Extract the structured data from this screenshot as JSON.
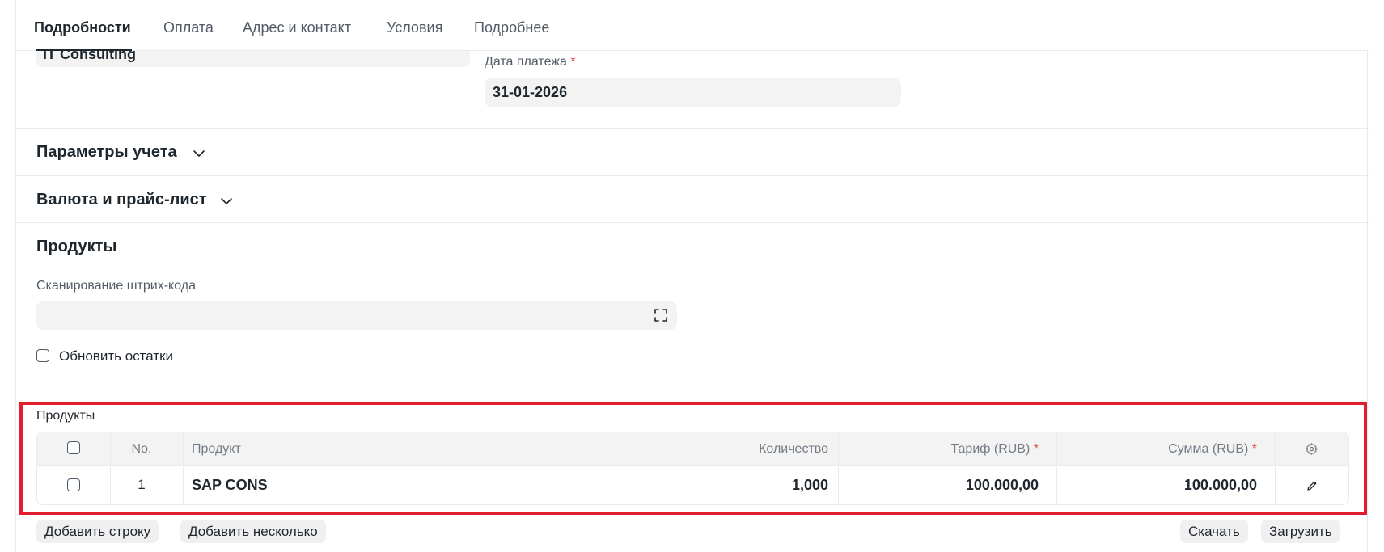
{
  "tabs": [
    {
      "label": "Подробности",
      "active": true
    },
    {
      "label": "Оплата",
      "active": false
    },
    {
      "label": "Адрес и контакт",
      "active": false
    },
    {
      "label": "Условия",
      "active": false
    },
    {
      "label": "Подробнее",
      "active": false
    }
  ],
  "top_field": {
    "value": "IT Consulting"
  },
  "payment_date": {
    "label": "Дата платежа",
    "required_mark": "*",
    "value": "31-01-2026"
  },
  "sections": {
    "accounting": "Параметры учета",
    "currency": "Валюта и прайс-лист",
    "products": "Продукты"
  },
  "barcode": {
    "label": "Сканирование штрих-кода",
    "value": "",
    "icon": "fullscreen-scan-icon"
  },
  "update_stock": {
    "label": "Обновить остатки",
    "checked": false
  },
  "items_grid": {
    "label": "Продукты",
    "columns": {
      "no": "No.",
      "product": "Продукт",
      "qty": "Количество",
      "rate": "Тариф (RUB)",
      "amount": "Сумма (RUB)",
      "required_mark": "*"
    },
    "rows": [
      {
        "no": "1",
        "product": "SAP CONS",
        "qty": "1,000",
        "rate": "100.000,00",
        "amount": "100.000,00"
      }
    ]
  },
  "buttons": {
    "add_row": "Добавить строку",
    "add_multiple": "Добавить несколько",
    "download": "Скачать",
    "upload": "Загрузить"
  },
  "colors": {
    "highlight": "#e31e2d",
    "required": "#e24c4c"
  }
}
